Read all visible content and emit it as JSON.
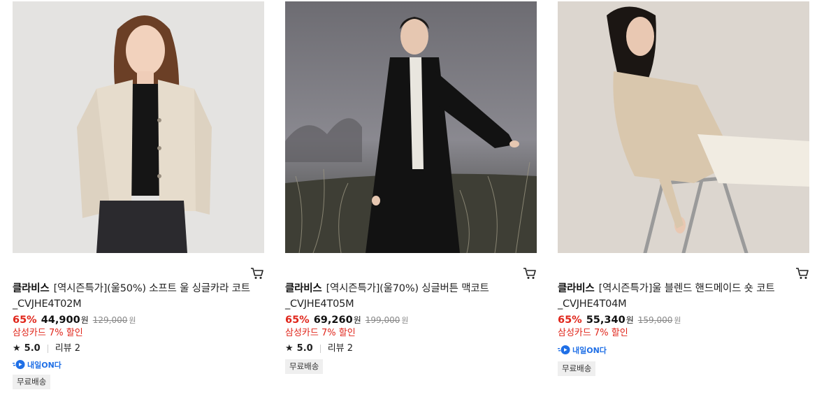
{
  "products": [
    {
      "brand": "클라비스",
      "name": "[역시즌특가](울50%) 소프트 울 싱글카라 코트_CVJHE4T02M",
      "discount_rate": "65%",
      "price": "44,900",
      "price_unit": "원",
      "original_price": "129,000",
      "original_unit": "원",
      "card_promo": "삼성카드 7% 할인",
      "rating": "5.0",
      "review_label": "리뷰 2",
      "delivery_badge": "내일ON다",
      "shipping_badge": "무료배송"
    },
    {
      "brand": "클라비스",
      "name": "[역시즌특가](울70%) 싱글버튼 맥코트_CVJHE4T05M",
      "discount_rate": "65%",
      "price": "69,260",
      "price_unit": "원",
      "original_price": "199,000",
      "original_unit": "원",
      "card_promo": "삼성카드 7% 할인",
      "rating": "5.0",
      "review_label": "리뷰 2",
      "shipping_badge": "무료배송"
    },
    {
      "brand": "클라비스",
      "name": "[역시즌특가]울 블렌드 핸드메이드 숏 코트_CVJHE4T04M",
      "discount_rate": "65%",
      "price": "55,340",
      "price_unit": "원",
      "original_price": "159,000",
      "original_unit": "원",
      "card_promo": "삼성카드 7% 할인",
      "delivery_badge": "내일ON다",
      "shipping_badge": "무료배송"
    }
  ],
  "icons": {
    "cart": "cart-icon",
    "star": "star-icon",
    "delivery": "truck-icon"
  },
  "colors": {
    "discount": "#e0261b",
    "delivery_blue": "#1f6fe6",
    "badge_bg": "#efefef"
  }
}
